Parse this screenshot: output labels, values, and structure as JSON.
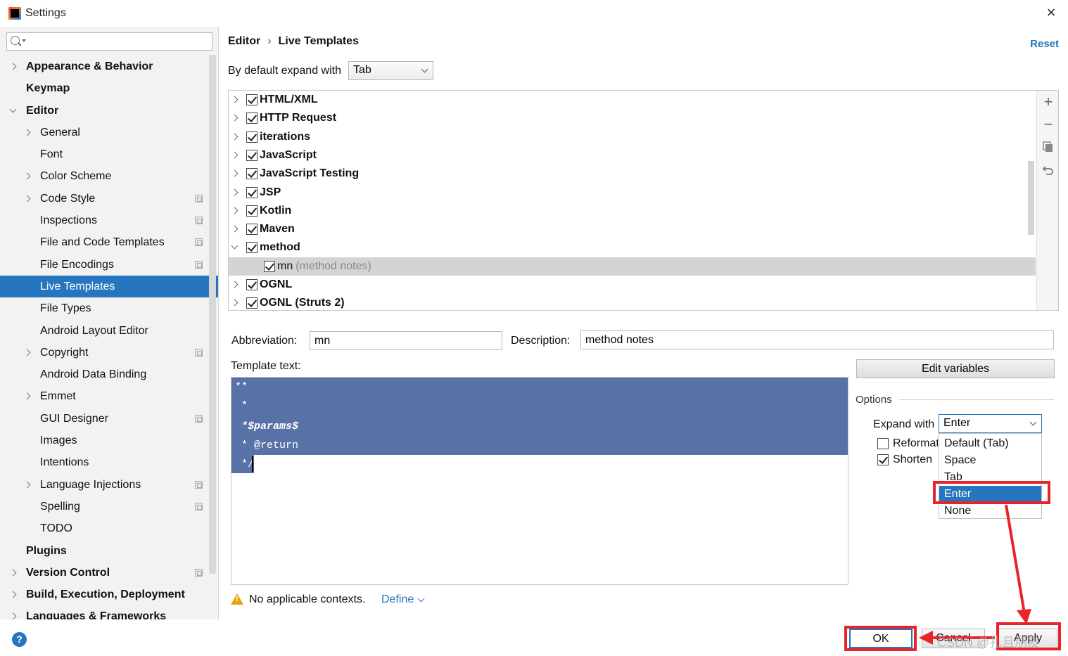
{
  "window": {
    "title": "Settings"
  },
  "search": {
    "placeholder": "",
    "value": ""
  },
  "sidebar": {
    "items": [
      {
        "label": "Appearance & Behavior",
        "level": 0,
        "bold": true,
        "arrow": "collapsed"
      },
      {
        "label": "Keymap",
        "level": 0,
        "bold": true,
        "arrow": "none"
      },
      {
        "label": "Editor",
        "level": 0,
        "bold": true,
        "arrow": "expanded"
      },
      {
        "label": "General",
        "level": 1,
        "arrow": "collapsed"
      },
      {
        "label": "Font",
        "level": 1,
        "arrow": "none"
      },
      {
        "label": "Color Scheme",
        "level": 1,
        "arrow": "collapsed"
      },
      {
        "label": "Code Style",
        "level": 1,
        "arrow": "collapsed",
        "project": true
      },
      {
        "label": "Inspections",
        "level": 1,
        "arrow": "none",
        "project": true
      },
      {
        "label": "File and Code Templates",
        "level": 1,
        "arrow": "none",
        "project": true
      },
      {
        "label": "File Encodings",
        "level": 1,
        "arrow": "none",
        "project": true
      },
      {
        "label": "Live Templates",
        "level": 1,
        "arrow": "none",
        "selected": true
      },
      {
        "label": "File Types",
        "level": 1,
        "arrow": "none"
      },
      {
        "label": "Android Layout Editor",
        "level": 1,
        "arrow": "none"
      },
      {
        "label": "Copyright",
        "level": 1,
        "arrow": "collapsed",
        "project": true
      },
      {
        "label": "Android Data Binding",
        "level": 1,
        "arrow": "none"
      },
      {
        "label": "Emmet",
        "level": 1,
        "arrow": "collapsed"
      },
      {
        "label": "GUI Designer",
        "level": 1,
        "arrow": "none",
        "project": true
      },
      {
        "label": "Images",
        "level": 1,
        "arrow": "none"
      },
      {
        "label": "Intentions",
        "level": 1,
        "arrow": "none"
      },
      {
        "label": "Language Injections",
        "level": 1,
        "arrow": "collapsed",
        "project": true
      },
      {
        "label": "Spelling",
        "level": 1,
        "arrow": "none",
        "project": true
      },
      {
        "label": "TODO",
        "level": 1,
        "arrow": "none"
      },
      {
        "label": "Plugins",
        "level": 0,
        "bold": true,
        "arrow": "none"
      },
      {
        "label": "Version Control",
        "level": 0,
        "bold": true,
        "arrow": "collapsed",
        "project": true
      },
      {
        "label": "Build, Execution, Deployment",
        "level": 0,
        "bold": true,
        "arrow": "collapsed"
      },
      {
        "label": "Languages & Frameworks",
        "level": 0,
        "bold": true,
        "arrow": "collapsed"
      }
    ]
  },
  "breadcrumb": {
    "parent": "Editor",
    "separator": "›",
    "current": "Live Templates"
  },
  "reset_label": "Reset",
  "expand_default": {
    "label": "By default expand with",
    "value": "Tab"
  },
  "templates": [
    {
      "name": "HTML/XML",
      "checked": true,
      "expanded": false
    },
    {
      "name": "HTTP Request",
      "checked": true,
      "expanded": false
    },
    {
      "name": "iterations",
      "checked": true,
      "expanded": false
    },
    {
      "name": "JavaScript",
      "checked": true,
      "expanded": false
    },
    {
      "name": "JavaScript Testing",
      "checked": true,
      "expanded": false
    },
    {
      "name": "JSP",
      "checked": true,
      "expanded": false
    },
    {
      "name": "Kotlin",
      "checked": true,
      "expanded": false
    },
    {
      "name": "Maven",
      "checked": true,
      "expanded": false
    },
    {
      "name": "method",
      "checked": true,
      "expanded": true
    },
    {
      "name": "mn",
      "desc": "(method notes)",
      "checked": true,
      "child": true
    },
    {
      "name": "OGNL",
      "checked": true,
      "expanded": false
    },
    {
      "name": "OGNL (Struts 2)",
      "checked": true,
      "expanded": false
    }
  ],
  "toolbar": {
    "add": "+",
    "remove": "−",
    "copy": "copy-icon",
    "restore": "undo-icon"
  },
  "abbreviation": {
    "label": "Abbreviation:",
    "value": "mn"
  },
  "description": {
    "label": "Description:",
    "value": "method notes"
  },
  "template_text": {
    "label": "Template text:",
    "lines": [
      "**",
      " *",
      " *$params$",
      " * @return",
      " */"
    ]
  },
  "edit_variables_label": "Edit variables",
  "options": {
    "title": "Options",
    "expand_with_label": "Expand with",
    "expand_with_value": "Enter",
    "reformat_label": "Reformat",
    "reformat_checked": false,
    "shorten_label": "Shorten",
    "shorten_checked": true,
    "dropdown_options": [
      "Default (Tab)",
      "Space",
      "Tab",
      "Enter",
      "None"
    ],
    "dropdown_selected": "Enter"
  },
  "context": {
    "warning": "No applicable contexts.",
    "define_label": "Define"
  },
  "buttons": {
    "ok": "OK",
    "cancel": "Cancel",
    "apply": "Apply"
  },
  "help": "?",
  "watermark": "CSDN @扎且朋友",
  "colors": {
    "selection": "#2675bf",
    "editor_selection": "#5872a7",
    "annotation": "#e8242b",
    "link": "#2675bf"
  }
}
